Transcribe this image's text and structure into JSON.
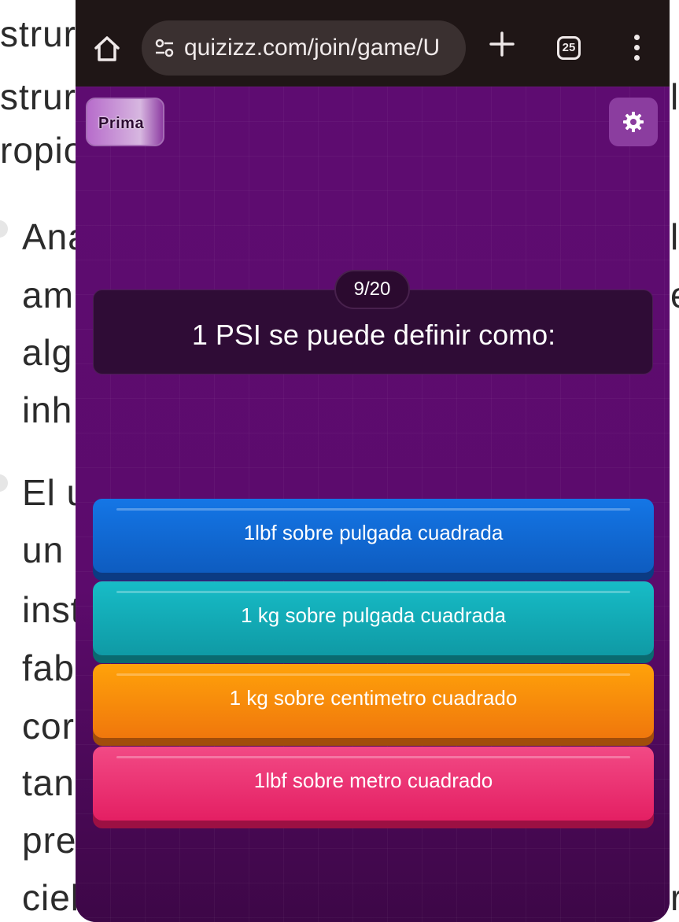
{
  "background_document": {
    "left_fragments": [
      "strur",
      "strur",
      "ropio",
      "Ana",
      "am",
      "alg",
      "inh",
      "El u",
      "un",
      "inst",
      "fab",
      "cor",
      "tan",
      "pre",
      "ciel"
    ],
    "right_fragments": [
      "l",
      "l",
      "e",
      "r"
    ]
  },
  "browser": {
    "url": "quizizz.com/join/game/U",
    "tab_count": "25",
    "icons": {
      "home": "home-icon",
      "site_settings": "tune-icon",
      "new_tab": "plus-icon",
      "tabs": "tab-switcher-icon",
      "menu": "more-vert-icon"
    }
  },
  "quiz": {
    "badge": "Prima",
    "progress": "9/20",
    "question": "1 PSI se puede definir como:",
    "options": [
      {
        "label": "1lbf sobre pulgada cuadrada",
        "color": "#1476e6"
      },
      {
        "label": "1 kg sobre pulgada cuadrada",
        "color": "#17bcc7"
      },
      {
        "label": "1 kg sobre centimetro cuadrado",
        "color": "#ffa20a"
      },
      {
        "label": "1lbf sobre metro cuadrado",
        "color": "#f24a85"
      }
    ],
    "colors": {
      "background": "#5d0c6e",
      "question_card": "#2f0c36"
    }
  }
}
